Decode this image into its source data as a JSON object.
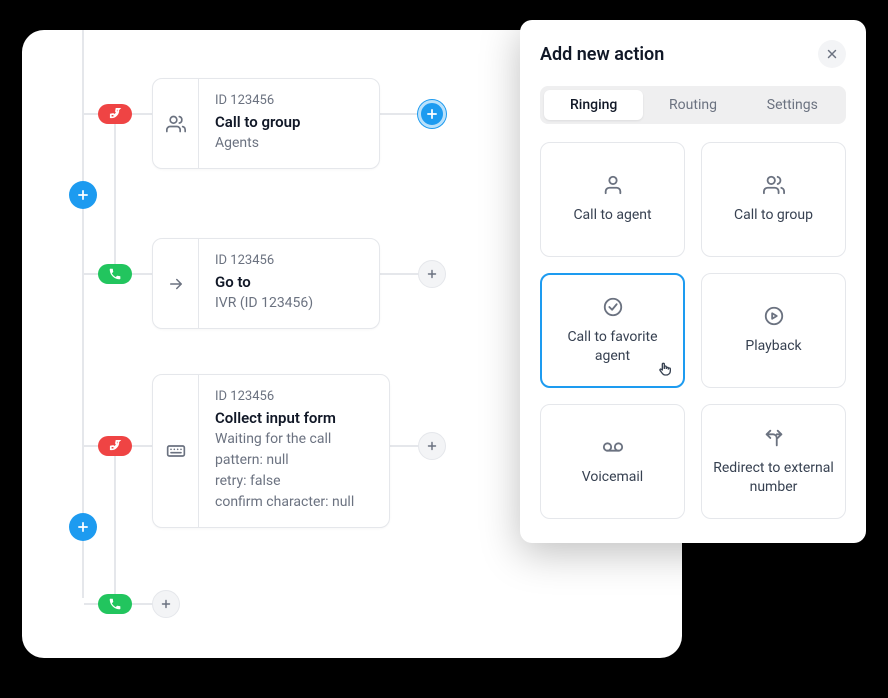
{
  "flow": {
    "node1": {
      "id": "ID 123456",
      "title": "Call to group",
      "sub": "Agents"
    },
    "node2": {
      "id": "ID 123456",
      "title": "Go to",
      "sub": "IVR (ID 123456)"
    },
    "node3": {
      "id": "ID 123456",
      "title": "Collect input form",
      "line1": "Waiting for the call",
      "line2": "pattern: null",
      "line3": "retry: false",
      "line4": "confirm character: null"
    }
  },
  "modal": {
    "title": "Add new action",
    "tabs": {
      "ringing": "Ringing",
      "routing": "Routing",
      "settings": "Settings"
    },
    "actions": {
      "call_agent": "Call to agent",
      "call_group": "Call to group",
      "call_fav": "Call to favorite agent",
      "playback": "Playback",
      "voicemail": "Voicemail",
      "redirect": "Redirect to external number"
    }
  }
}
